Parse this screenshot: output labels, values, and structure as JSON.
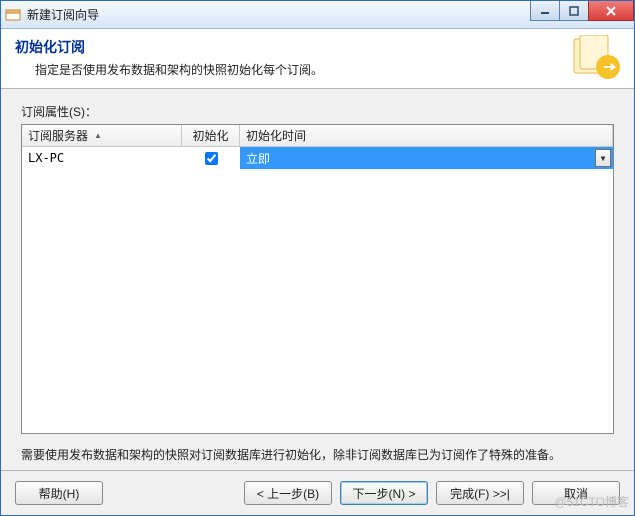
{
  "window": {
    "title": "新建订阅向导"
  },
  "header": {
    "title": "初始化订阅",
    "subtitle": "指定是否使用发布数据和架构的快照初始化每个订阅。"
  },
  "properties_label": "订阅属性(S)：",
  "grid": {
    "columns": {
      "server": "订阅服务器",
      "init": "初始化",
      "init_time": "初始化时间"
    },
    "rows": [
      {
        "server": "LX-PC",
        "init_checked": true,
        "time": "立即"
      }
    ]
  },
  "note": "需要使用发布数据和架构的快照对订阅数据库进行初始化，除非订阅数据库已为订阅作了特殊的准备。",
  "buttons": {
    "help": "帮助(H)",
    "back": "< 上一步(B)",
    "next": "下一步(N) >",
    "finish": "完成(F) >>|",
    "cancel": "取消"
  },
  "watermark": "@51CTO博客"
}
